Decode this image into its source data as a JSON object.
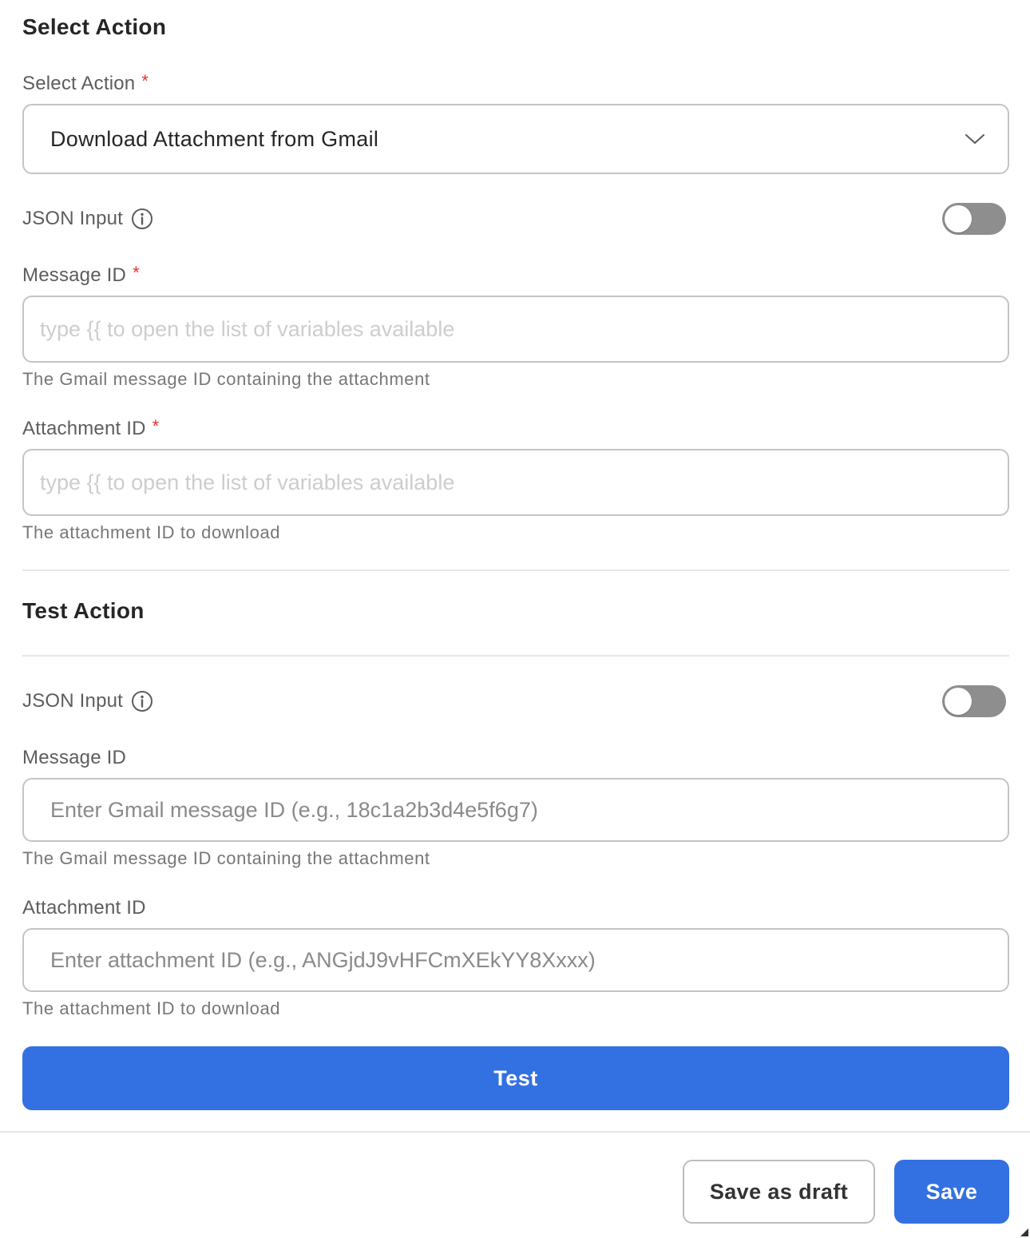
{
  "select_action": {
    "section_title": "Select Action",
    "select_label": "Select Action",
    "required_mark": "*",
    "select_value": "Download Attachment from Gmail",
    "json_input_label": "JSON Input",
    "json_input_enabled": false,
    "message_id": {
      "label": "Message ID",
      "placeholder": "type {{ to open the list of variables available",
      "helper": "The Gmail message ID containing the attachment"
    },
    "attachment_id": {
      "label": "Attachment ID",
      "placeholder": "type {{ to open the list of variables available",
      "helper": "The attachment ID to download"
    }
  },
  "test_action": {
    "section_title": "Test Action",
    "json_input_label": "JSON Input",
    "json_input_enabled": false,
    "message_id": {
      "label": "Message ID",
      "placeholder": "Enter Gmail message ID (e.g., 18c1a2b3d4e5f6g7)",
      "helper": "The Gmail message ID containing the attachment"
    },
    "attachment_id": {
      "label": "Attachment ID",
      "placeholder": "Enter attachment ID (e.g., ANGjdJ9vHFCmXEkYY8Xxxx)",
      "helper": "The attachment ID to download"
    },
    "test_button_label": "Test"
  },
  "footer": {
    "save_draft_label": "Save as draft",
    "save_label": "Save"
  },
  "colors": {
    "primary": "#3370e2",
    "required": "#e0352b",
    "toggle_off": "#8e8e8e"
  },
  "icons": {
    "info": "info-circle-icon",
    "chevron": "chevron-down-icon"
  }
}
